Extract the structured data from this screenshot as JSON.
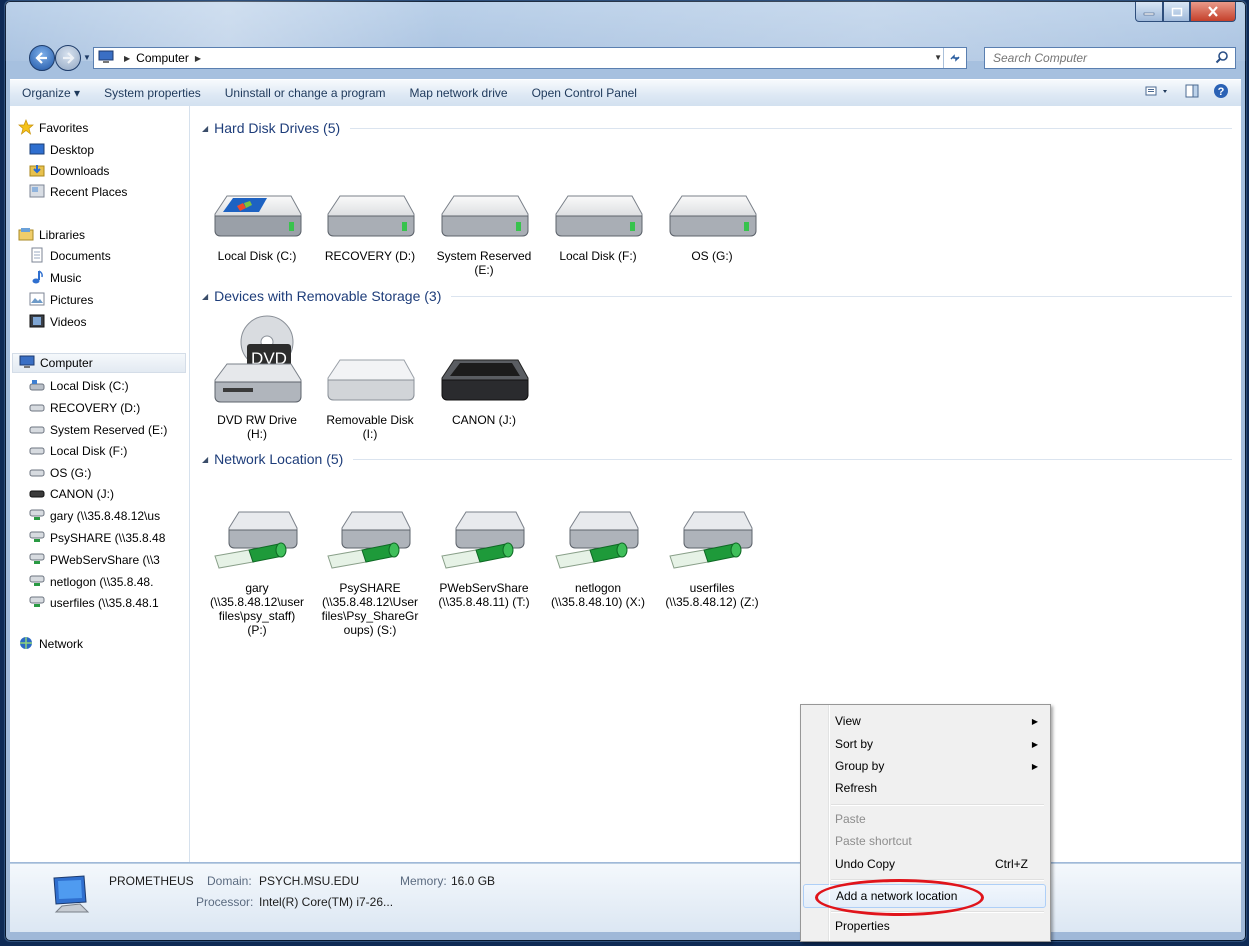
{
  "window": {
    "title": ""
  },
  "address": {
    "crumbs": [
      "Computer"
    ],
    "search_placeholder": "Search Computer"
  },
  "toolbar": {
    "organize": "Organize ▾",
    "system_properties": "System properties",
    "uninstall": "Uninstall or change a program",
    "map_drive": "Map network drive",
    "control_panel": "Open Control Panel"
  },
  "nav": {
    "favorites": {
      "label": "Favorites",
      "items": [
        "Desktop",
        "Downloads",
        "Recent Places"
      ]
    },
    "libraries": {
      "label": "Libraries",
      "items": [
        "Documents",
        "Music",
        "Pictures",
        "Videos"
      ]
    },
    "computer": {
      "label": "Computer",
      "items": [
        "Local Disk (C:)",
        "RECOVERY (D:)",
        "System Reserved (E:)",
        "Local Disk (F:)",
        "OS (G:)",
        "CANON (J:)",
        "gary (\\\\35.8.48.12\\us",
        "PsySHARE (\\\\35.8.48",
        "PWebServShare (\\\\3",
        "netlogon (\\\\35.8.48.",
        "userfiles (\\\\35.8.48.1"
      ]
    },
    "network": {
      "label": "Network"
    }
  },
  "groups": {
    "hdd": {
      "header": "Hard Disk Drives (5)",
      "items": [
        {
          "line1": "Local Disk (C:)",
          "line2": ""
        },
        {
          "line1": "RECOVERY (D:)",
          "line2": ""
        },
        {
          "line1": "System Reserved",
          "line2": "(E:)"
        },
        {
          "line1": "Local Disk (F:)",
          "line2": ""
        },
        {
          "line1": "OS (G:)",
          "line2": ""
        }
      ]
    },
    "removable": {
      "header": "Devices with Removable Storage (3)",
      "items": [
        {
          "line1": "DVD RW Drive",
          "line2": "(H:)",
          "badge": "DVD"
        },
        {
          "line1": "Removable Disk",
          "line2": "(I:)"
        },
        {
          "line1": "CANON (J:)",
          "line2": ""
        }
      ]
    },
    "network": {
      "header": "Network Location (5)",
      "items": [
        {
          "lines": [
            "gary",
            "(\\\\35.8.48.12\\user",
            "files\\psy_staff)",
            "(P:)"
          ]
        },
        {
          "lines": [
            "PsySHARE",
            "(\\\\35.8.48.12\\User",
            "files\\Psy_ShareGr",
            "oups) (S:)"
          ]
        },
        {
          "lines": [
            "PWebServShare",
            "(\\\\35.8.48.11) (T:)"
          ]
        },
        {
          "lines": [
            "netlogon",
            "(\\\\35.8.48.10) (X:)"
          ]
        },
        {
          "lines": [
            "userfiles",
            "(\\\\35.8.48.12) (Z:)"
          ]
        }
      ]
    }
  },
  "details": {
    "name": "PROMETHEUS",
    "domain_label": "Domain:",
    "domain_value": "PSYCH.MSU.EDU",
    "memory_label": "Memory:",
    "memory_value": "16.0 GB",
    "processor_label": "Processor:",
    "processor_value": "Intel(R) Core(TM) i7-26..."
  },
  "context_menu": {
    "view": "View",
    "sort_by": "Sort by",
    "group_by": "Group by",
    "refresh": "Refresh",
    "paste": "Paste",
    "paste_shortcut": "Paste shortcut",
    "undo_copy": "Undo Copy",
    "undo_shortcut": "Ctrl+Z",
    "add_network_location": "Add a network location",
    "properties": "Properties"
  },
  "colors": {
    "accent": "#1e3d7a",
    "callout": "#e0141b",
    "drive_green": "#1e9a3a"
  }
}
